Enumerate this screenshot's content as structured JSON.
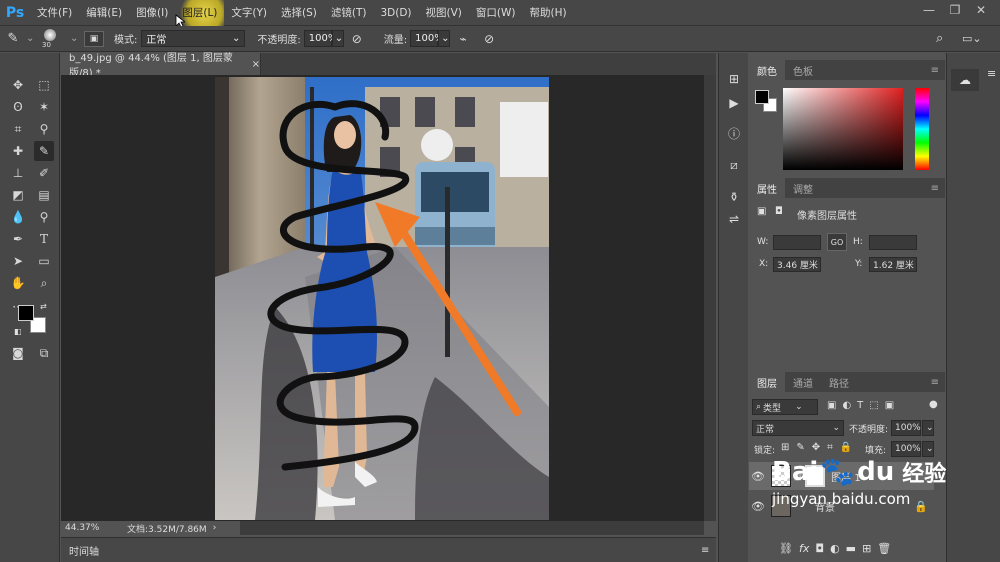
{
  "app": {
    "logo": "Ps"
  },
  "menu": [
    "文件(F)",
    "编辑(E)",
    "图像(I)",
    "图层(L)",
    "文字(Y)",
    "选择(S)",
    "滤镜(T)",
    "3D(D)",
    "视图(V)",
    "窗口(W)",
    "帮助(H)"
  ],
  "menu_active_index": 3,
  "options": {
    "brush_size": "30",
    "mode_label": "模式:",
    "mode_value": "正常",
    "opacity_label": "不透明度:",
    "opacity_value": "100%",
    "flow_label": "流量:",
    "flow_value": "100%"
  },
  "document": {
    "tab_title": "b_49.jpg @ 44.4% (图层 1, 图层蒙版/8) *",
    "zoom": "44.37%",
    "doc_size": "文档:3.52M/7.86M"
  },
  "timeline": {
    "label": "时间轴"
  },
  "color_panel": {
    "tab_color": "颜色",
    "tab_swatches": "色板",
    "base_color": "#e02020"
  },
  "properties_panel": {
    "tab_properties": "属性",
    "tab_adjustments": "调整",
    "title": "像素图层属性",
    "w_label": "W:",
    "h_label": "H:",
    "link_label": "GO",
    "x_label": "X:",
    "x_value": "3.46 厘米",
    "y_label": "Y:",
    "y_value": "1.62 厘米"
  },
  "layers_panel": {
    "tab_layers": "图层",
    "tab_channels": "通道",
    "tab_paths": "路径",
    "filter_kind": "类型",
    "blend_mode": "正常",
    "opacity_label": "不透明度:",
    "opacity_value": "100%",
    "lock_label": "锁定:",
    "fill_label": "填充:",
    "fill_value": "100%",
    "layers": [
      {
        "name": "图层 1"
      },
      {
        "name": "背景"
      }
    ],
    "bottom_icons": [
      "link-icon",
      "fx-icon",
      "mask-icon",
      "adjustment-icon",
      "folder-icon",
      "new-layer-icon",
      "trash-icon"
    ]
  },
  "watermark": {
    "brand": "Bai",
    "brand2": "du",
    "product": "经验",
    "url": "jingyan.baidu.com"
  }
}
